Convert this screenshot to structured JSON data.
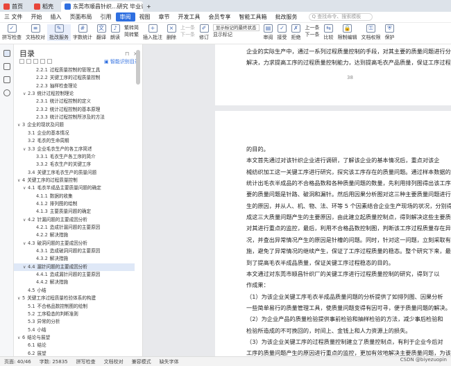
{
  "titlebar": {
    "tabs": [
      {
        "label": "首页",
        "icon": "wps-home-icon",
        "color": "#e8463a"
      },
      {
        "label": "稻壳",
        "icon": "docer-icon",
        "color": "#e8463a"
      },
      {
        "label": "东莞市顺昌针织...研究 毕业论文",
        "icon": "word-doc-icon",
        "color": "#2f6fe0",
        "active": true
      }
    ],
    "new_tab": "+"
  },
  "menubar": {
    "file": "三 文件",
    "items": [
      "开始",
      "插入",
      "页面布局",
      "引用",
      "审阅",
      "视图",
      "章节",
      "开发工具",
      "会员专享",
      "智能工具箱",
      "批改服务"
    ],
    "active": "审阅",
    "search_placeholder": "Q 查找命令、搜索模板"
  },
  "toolbar": {
    "spellcheck": "拼写检查",
    "doc_proof": "文档校对",
    "correction": "批改服务",
    "wordcount": "字数统计",
    "translate": "翻译",
    "read_aloud": "朗读",
    "trad_simp": [
      "繁转简",
      "简转繁"
    ],
    "insert_comment": "插入批注",
    "delete": "删除",
    "prev": "上一条",
    "next": "下一条",
    "track": "修订",
    "display_mode": "显示标记的最终状态",
    "show_markup": "显示标记",
    "review": "审阅",
    "accept": "接受",
    "reject": "拒绝",
    "prev2": "上一条",
    "next2": "下一条",
    "compare": "比较",
    "restrict": "限制编辑",
    "doc_permission": "文档权限",
    "protect": "保护"
  },
  "outline": {
    "title": "目录",
    "smart_dir": "智能识别目录",
    "items": [
      {
        "num": "2.2.1",
        "text": "过程质量控制的管理工具",
        "level": 3
      },
      {
        "num": "2.2.2",
        "text": "关键工序的过程质量控制",
        "level": 3
      },
      {
        "num": "2.2.3",
        "text": "抽样检查理论",
        "level": 3
      },
      {
        "num": "2.3",
        "text": "统计过程控制理论",
        "level": 2,
        "caret": "v"
      },
      {
        "num": "2.3.1",
        "text": "统计过程控制的定义",
        "level": 3
      },
      {
        "num": "2.3.2",
        "text": "统计过程控制的基本原理",
        "level": 3
      },
      {
        "num": "2.3.3",
        "text": "统计过程控制所涉及的方法",
        "level": 3
      },
      {
        "num": "3",
        "text": "企业的现状及问题",
        "level": 1,
        "caret": "v"
      },
      {
        "num": "3.1",
        "text": "企业的基本情况",
        "level": 2
      },
      {
        "num": "3.2",
        "text": "毛衣的生命周期",
        "level": 2
      },
      {
        "num": "3.3",
        "text": "企业毛衣生产的各工序简述",
        "level": 2,
        "caret": "v"
      },
      {
        "num": "3.3.1",
        "text": "毛衣生产各工序的简介",
        "level": 3
      },
      {
        "num": "3.3.2",
        "text": "毛衣生产的关键工序",
        "level": 3
      },
      {
        "num": "3.4",
        "text": "关键工序毛衣生产的质量问题",
        "level": 2
      },
      {
        "num": "4",
        "text": "关键工序的过程质量控制",
        "level": 1,
        "caret": "v"
      },
      {
        "num": "4.1",
        "text": "毛衣半成品主要质量问题的确定",
        "level": 2,
        "caret": "v"
      },
      {
        "num": "4.1.1",
        "text": "数据的收集",
        "level": 3
      },
      {
        "num": "4.1.2",
        "text": "排列图的绘制",
        "level": 3
      },
      {
        "num": "4.1.3",
        "text": "主要质量问题的确定",
        "level": 3
      },
      {
        "num": "4.2",
        "text": "针漏问题的主要成因分析",
        "level": 2,
        "caret": "v"
      },
      {
        "num": "4.2.1",
        "text": "造成针漏问题的主要原因",
        "level": 3
      },
      {
        "num": "4.2.2",
        "text": "解决措施",
        "level": 3
      },
      {
        "num": "4.3",
        "text": "破洞问题的主要成因分析",
        "level": 2,
        "caret": "v"
      },
      {
        "num": "4.3.1",
        "text": "造成破洞问题的主要原因",
        "level": 3
      },
      {
        "num": "4.3.2",
        "text": "解决措施",
        "level": 3
      },
      {
        "num": "4.4",
        "text": "漏针问题的主要成因分析",
        "level": 2,
        "caret": "v",
        "highlight": true
      },
      {
        "num": "4.4.1",
        "text": "造成漏针问题的主要原因",
        "level": 3
      },
      {
        "num": "4.4.2",
        "text": "解决措施",
        "level": 3
      },
      {
        "num": "4.5",
        "text": "小结",
        "level": 2
      },
      {
        "num": "5",
        "text": "关键工序过程质量检验体系的构建",
        "level": 1,
        "caret": "v"
      },
      {
        "num": "5.1",
        "text": "不合格品数控制图的绘制",
        "level": 2
      },
      {
        "num": "5.2",
        "text": "工序稳态的判断准则",
        "level": 2
      },
      {
        "num": "5.3",
        "text": "异常的分析",
        "level": 2
      },
      {
        "num": "5.4",
        "text": "小结",
        "level": 2
      },
      {
        "num": "6",
        "text": "结论与展望",
        "level": 1,
        "caret": "v"
      },
      {
        "num": "6.1",
        "text": "结论",
        "level": 2
      },
      {
        "num": "6.2",
        "text": "展望",
        "level": 2
      }
    ]
  },
  "document": {
    "page1_lines": [
      "企业的实际生产中，通过一系列过程质量控制的手段，对其主要的质量问题进行分",
      "解决，力求提高工序的过程质量控制能力，达到提高毛衣产品质量，保证工序过程"
    ],
    "page_number": "38",
    "page2_lines": [
      "的目的。",
      "    本文首先通过对该针织企业进行调研，了解该企业的基本情况后，重点对该企",
      "械纺织加工这一关键工序进行研究，探究该工序存在的质量问题。通过样本数据的收",
      "统计出毛衣半成品的不合格品数和各种质量问题的数量，先利用排列图得出该工序",
      "要的质量问题是针路、破洞和漏针。然后用因果分析图对这三种主要质量问题进行",
      "生的原因，并从人、机、物、法、环等 5 个因素结合企业生产现场的状况，分别得",
      "成这三大质量问题产生的主要原因，由此建立起质量控制点，得到解决这些主要质量问题",
      "对其进行重点的监控，最后，利用不合格品数控制图，判断该工序过程质量存在异",
      "况，并查出异常情况产生的原因是针槽的问题。同时，针对这一问题，立刻采取有",
      "施，避免了异常情况的继续产生，保证了工序过程质量的稳态。整个研究下来，最",
      "到了提高毛衣半成品质量，保证关键工序过程稳态的目的。",
      "    本文通过对东莞市顺昌针织厂的关键工序进行过程质量控制的研究，得到了以",
      "作成果：",
      "    （1）为该企业关键工序毛衣半成品质量问题的分析提供了如排列图、因果分析",
      "一些简单易行的质量管理工具，使质量问题变得有因可寻，便于质量问题的解决。",
      "    （2）为企业产品的质量检验提供事前检验和抽样检验的方法，减少事后检验和",
      "检验所造成的不可挽回的，时间上、金钱上和人力资源上的损失。",
      "    （3）为该企业关键工序的过程质量控制建立了质量控制点，有利于企业今后对",
      "工序的质量问题产生的原因进行重点的监控，更加有效地解决主要质量问题，为该企业引"
    ]
  },
  "statusbar": {
    "page": "页面: 40/46",
    "words": "字数: 25835",
    "spell": "拼写检查",
    "proof": "文档校对",
    "compat": "兼容模式",
    "font_missing": "缺失字体"
  },
  "watermark": "CSDN @biyezuopin"
}
